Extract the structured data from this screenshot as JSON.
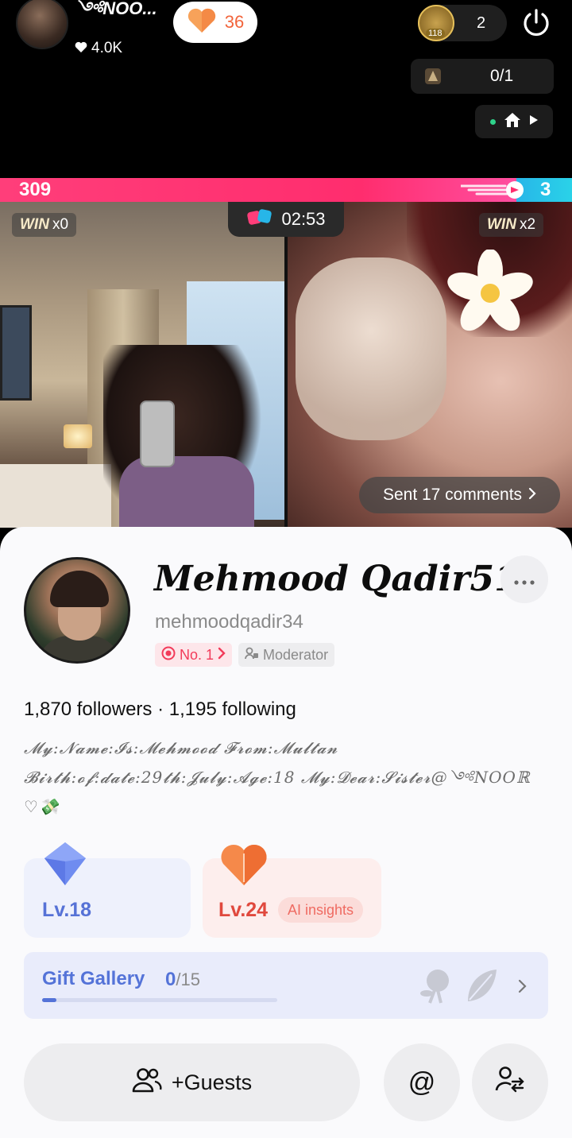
{
  "top": {
    "host_name": "༺NOO...",
    "host_likes": "4.0K",
    "like_count": "36",
    "viewer_badge": "118",
    "viewer_count": "2",
    "rank_value": "0/1"
  },
  "battle": {
    "left_score": "309",
    "right_score": "3",
    "left_win_label": "WIN",
    "left_win_count": "x0",
    "right_win_label": "WIN",
    "right_win_count": "x2",
    "timer": "02:53",
    "sent_comments": "Sent 17 comments"
  },
  "profile": {
    "name": "Mehmood Qadir516",
    "handle": "mehmoodqadir34",
    "rank_tag": "No. 1",
    "role_tag": "Moderator",
    "follow_line": "1,870 followers · 1,195 following",
    "bio_line1": "𝓜𝔂:𝓝𝓪𝓶𝓮:𝓘𝓼:𝓜𝓮𝓱𝓶𝓸𝓸𝓭 𝓕𝓻𝓸𝓶:𝓜𝓾𝓵𝓽𝓪𝓷",
    "bio_line2": "𝓑𝓲𝓻𝓽𝓱:𝓸𝓯:𝓭𝓪𝓽𝓮:29𝓽𝓱:𝓙𝓾𝓵𝔂:𝓐𝓰𝓮:18 𝓜𝔂:𝓓𝓮𝓪𝓻:𝓢𝓲𝓼𝓽𝓮𝓻@༺NOOℝ",
    "bio_line3": "♡💸"
  },
  "levels": {
    "level_a": "Lv.18",
    "level_b": "Lv.24",
    "ai_badge": "AI insights"
  },
  "gallery": {
    "title": "Gift Gallery",
    "count": "0",
    "total": "/15",
    "progress": 0.06
  },
  "actions": {
    "guests_label": "+Guests",
    "mention_label": "@"
  },
  "colors": {
    "left_team": "#ff2d6e",
    "right_team": "#27b6e8",
    "accent_blue": "#5473d8",
    "accent_red": "#e0493e"
  }
}
